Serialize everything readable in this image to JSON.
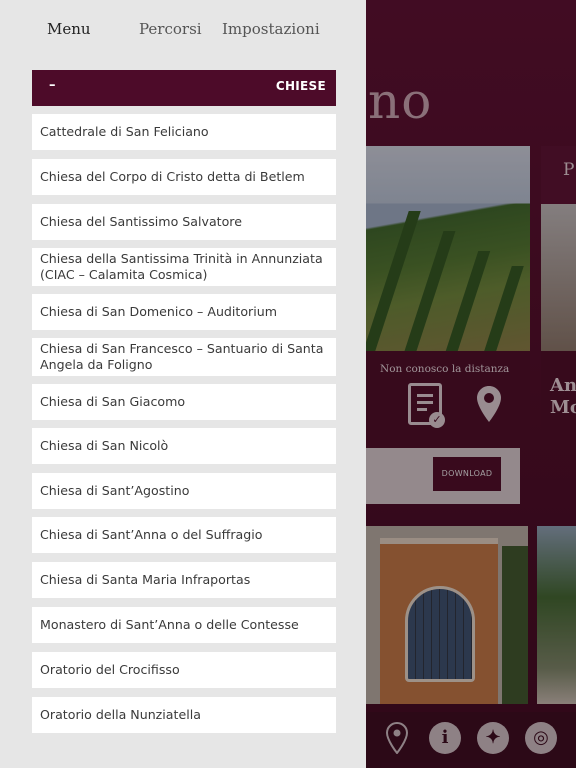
{
  "background": {
    "title_fragment": "no",
    "distance_label": "Non conosco la distanza",
    "right_card_letter": "P",
    "right_box_text": "An Mo",
    "download_label": "DOWNLOAD",
    "bottom_icons": [
      "location-pin-icon",
      "info-icon",
      "compass-star-icon",
      "target-icon"
    ]
  },
  "drawer": {
    "tabs": [
      {
        "label": "Menu",
        "active": true
      },
      {
        "label": "Percorsi",
        "active": false
      },
      {
        "label": "Impostazioni",
        "active": false
      }
    ],
    "category": {
      "collapse_sign": "–",
      "title": "CHIESE"
    },
    "items": [
      "Cattedrale di San Feliciano",
      "Chiesa del Corpo di Cristo detta di Betlem",
      "Chiesa del Santissimo Salvatore",
      "Chiesa della Santissima Trinità in Annunziata (CIAC – Calamita Cosmica)",
      "Chiesa di San Domenico – Auditorium",
      "Chiesa di San Francesco – Santuario di Santa Angela da Foligno",
      "Chiesa di San Giacomo",
      "Chiesa di San Nicolò",
      "Chiesa di Sant’Agostino",
      "Chiesa di Sant’Anna o del Suffragio",
      "Chiesa di Santa Maria Infraportas",
      "Monastero di Sant’Anna o delle Contesse",
      "Oratorio del Crocifisso",
      "Oratorio della Nunziatella"
    ]
  },
  "colors": {
    "brand": "#4d0b29",
    "drawer_bg": "#e6e6e6",
    "item_bg": "#ffffff"
  }
}
